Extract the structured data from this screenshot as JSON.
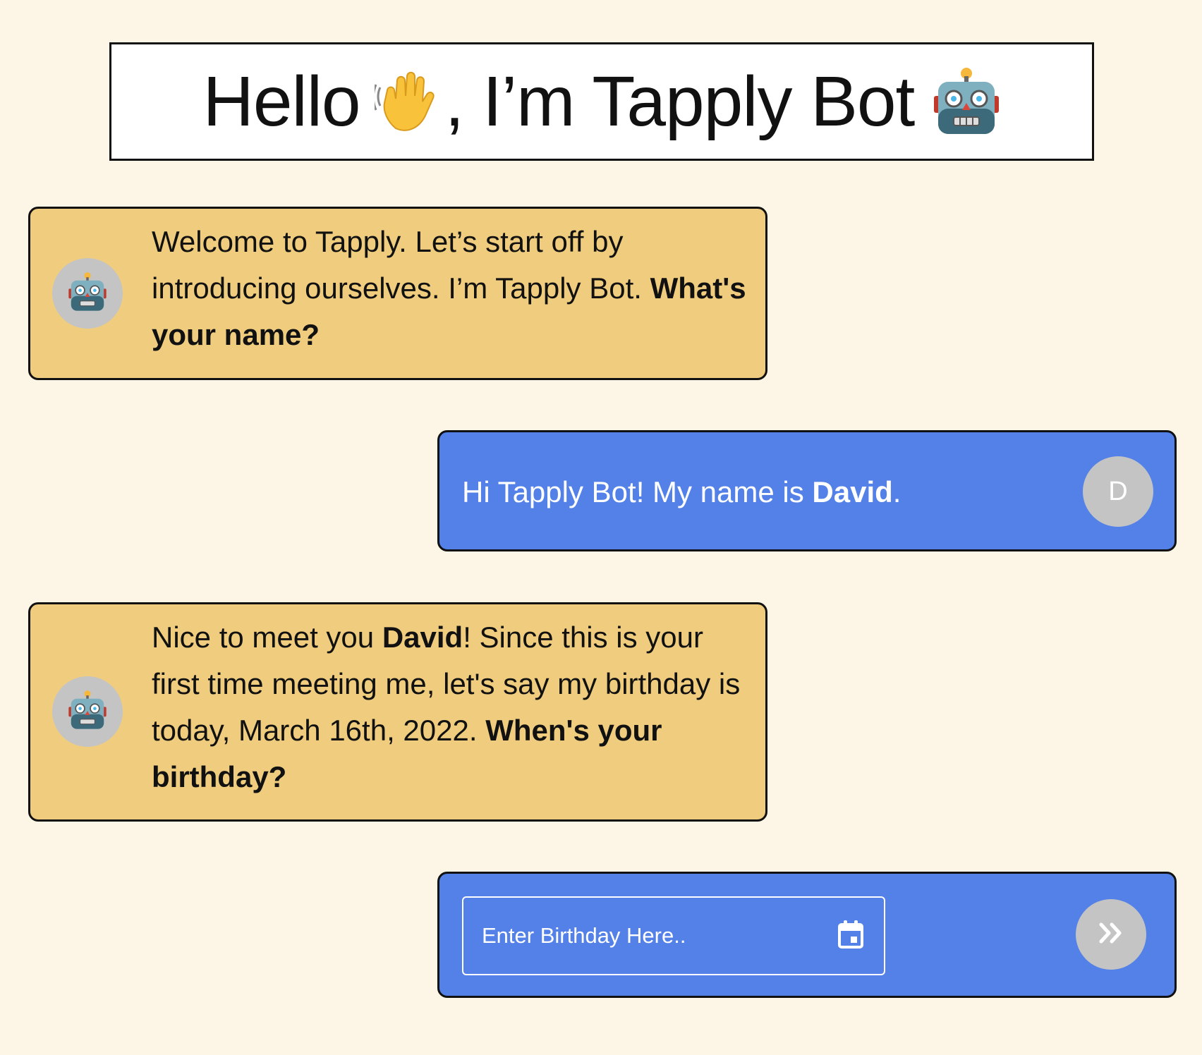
{
  "header": {
    "title_hello": "Hello",
    "title_rest": ", I’m Tapply Bot",
    "wave_icon": "waving-hand-icon",
    "robot_icon": "robot-icon"
  },
  "messages": [
    {
      "sender": "bot",
      "avatar_icon": "robot-icon",
      "text_plain": "Welcome to Tapply. Let’s start off by introducing ourselves. I’m Tapply Bot.",
      "text_bold": "What's your name?"
    },
    {
      "sender": "user",
      "avatar_letter": "D",
      "text_before": "Hi Tapply Bot! My name is ",
      "text_bold": "David",
      "text_after": "."
    },
    {
      "sender": "bot",
      "avatar_icon": "robot-icon",
      "text_part1": "Nice to meet you ",
      "text_bold_name": "David",
      "text_part2": "! Since this is your first time meeting me, let's say my birthday is today, March 16th, 2022. ",
      "text_bold_question": "When's your birthday?"
    }
  ],
  "input": {
    "placeholder": "Enter Birthday Here..",
    "calendar_icon": "calendar-icon",
    "submit_icon": "double-chevron-right-icon"
  },
  "colors": {
    "background": "#fdf5e6",
    "bot_bubble": "#f0cd7e",
    "user_bubble": "#5381e8",
    "avatar": "#c4c4c4"
  }
}
